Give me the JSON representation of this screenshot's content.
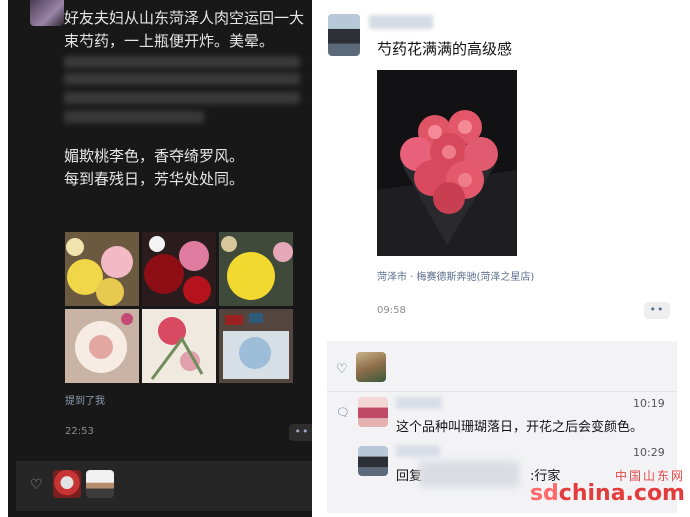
{
  "left_post": {
    "text_line1": "好友夫妇从山东菏泽人肉空运回一大",
    "text_line2": "束芍药，一上瓶便开炸。美晕。",
    "poem_line1": "媚欺桃李色，香夺绮罗风。",
    "poem_line2": "每到春残日，芳华处处同。",
    "mention_label": "提到了我",
    "time": "22:53",
    "more_label": "••"
  },
  "right_post": {
    "caption": "芍药花满满的高级感",
    "location": "菏泽市 · 梅赛德斯奔驰(菏泽之星店)",
    "time": "09:58",
    "more_label": "••",
    "comments": [
      {
        "time": "10:19",
        "text": "这个品种叫珊瑚落日，开花之后会变颜色。"
      },
      {
        "time": "10:29",
        "text_before": "回复",
        "text_after": ":行家"
      }
    ]
  },
  "watermark": {
    "chinese": "中国山东网",
    "logo_prefix": "sd",
    "logo_suffix": "china.com"
  },
  "colors": {
    "dark_bg": "#181818",
    "link_blue": "#5b6d8c",
    "watermark_red": "#e23c3c"
  },
  "icons": [
    "heart-icon",
    "comment-icon",
    "more-dots-icon"
  ]
}
